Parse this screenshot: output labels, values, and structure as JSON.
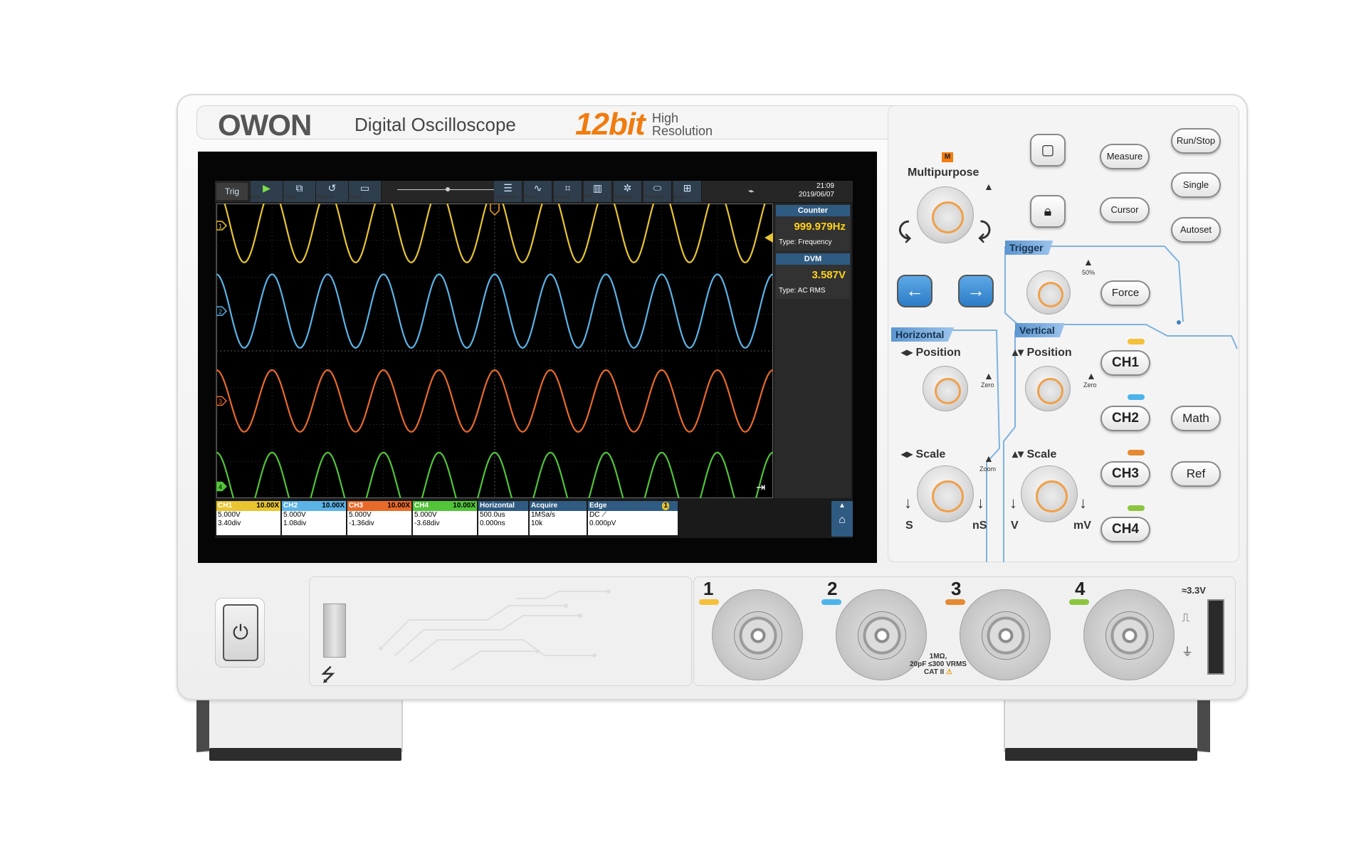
{
  "header": {
    "brand": "OWON",
    "model": "Digital Oscilloscope",
    "bits": "12bit",
    "bits_sub_1": "High",
    "bits_sub_2": "Resolution"
  },
  "screen": {
    "trig_label": "Trig",
    "toolbar": [
      {
        "label": "Run",
        "icon": "play-icon"
      },
      {
        "label": "Copy",
        "icon": "copy-icon"
      },
      {
        "label": "Default",
        "icon": "reset-icon"
      },
      {
        "label": "Zoom",
        "icon": "zoom-icon"
      },
      {
        "label": "Snapshot",
        "icon": "snapshot-icon"
      },
      {
        "label": "Force",
        "icon": "force-icon"
      },
      {
        "label": "Cursor",
        "icon": "cursor-icon"
      },
      {
        "label": "FFT",
        "icon": "fft-icon"
      },
      {
        "label": "AutoSet",
        "icon": "autoset-icon"
      },
      {
        "label": "XY Mode",
        "icon": "xy-icon"
      },
      {
        "label": "More",
        "icon": "more-icon"
      }
    ],
    "time": "21:09",
    "date": "2019/06/07",
    "side": {
      "counter_head": "Counter",
      "counter_value": "999.979Hz",
      "counter_type": "Type: Frequency",
      "dvm_head": "DVM",
      "dvm_value": "3.587V",
      "dvm_type": "Type: AC RMS"
    },
    "channels": [
      {
        "name": "CH1",
        "probe": "10.00X",
        "volts": "5.000V",
        "offset": "3.40div",
        "color": "#e8c531"
      },
      {
        "name": "CH2",
        "probe": "10.00X",
        "volts": "5.000V",
        "offset": "1.08div",
        "color": "#5bb3e6"
      },
      {
        "name": "CH3",
        "probe": "10.00X",
        "volts": "5.000V",
        "offset": "-1.36div",
        "color": "#e86a2a"
      },
      {
        "name": "CH4",
        "probe": "10.00X",
        "volts": "5.000V",
        "offset": "-3.68div",
        "color": "#52c43a"
      }
    ],
    "horizontal": {
      "head": "Horizontal",
      "timebase": "500.0us",
      "pos": "0.000ns"
    },
    "acquire": {
      "head": "Acquire",
      "rate": "1MSa/s",
      "depth": "10k"
    },
    "trigger": {
      "head": "Edge",
      "coupling": "DC",
      "level": "0.000pV",
      "source": "1"
    },
    "markers": [
      "1",
      "2",
      "3",
      "4"
    ]
  },
  "panel": {
    "m_badge": "M",
    "multipurpose": "Multipurpose",
    "buttons": {
      "run_stop": "Run/Stop",
      "single": "Single",
      "autoset": "Autoset",
      "measure": "Measure",
      "cursor": "Cursor",
      "force": "Force",
      "ch1": "CH1",
      "ch2": "CH2",
      "ch3": "CH3",
      "ch4": "CH4",
      "math": "Math",
      "ref": "Ref"
    },
    "tags": {
      "trigger": "Trigger",
      "horizontal": "Horizontal",
      "vertical": "Vertical"
    },
    "fifty": "50%",
    "position": "Position",
    "scale": "Scale",
    "zero": "Zero",
    "zoom": "Zoom",
    "s": "S",
    "ns": "nS",
    "v": "V",
    "mv": "mV"
  },
  "front": {
    "inputs": [
      "1",
      "2",
      "3",
      "4"
    ],
    "spec_1": "1MΩ,",
    "spec_2": "20pF ≤300 VRMS",
    "spec_3": "CAT II",
    "cal": "≈3.3V"
  }
}
